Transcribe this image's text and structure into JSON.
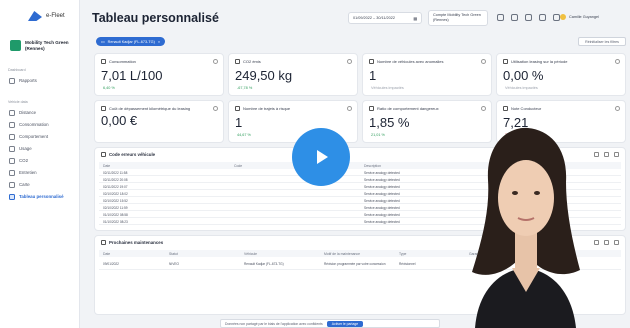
{
  "brand": {
    "name": "e-Fleet"
  },
  "tenant": {
    "name": "Mobility Tech Green (Rennes)"
  },
  "sidebar": {
    "section_general": "Dashboard",
    "section_vehicle": "Vehicle data",
    "items": [
      {
        "label": "Rapports"
      },
      {
        "label": "Distance"
      },
      {
        "label": "Consommation"
      },
      {
        "label": "Comportement"
      },
      {
        "label": "Usage"
      },
      {
        "label": "CO2"
      },
      {
        "label": "Entretien"
      },
      {
        "label": "Carte"
      },
      {
        "label": "Tableau personnalisé"
      }
    ]
  },
  "header": {
    "title": "Tableau personnalisé",
    "date_range": "01/09/2022 – 30/11/2022",
    "company_label": "Compte Mobility Tech Green (Rennes)",
    "user_name": "Camille Guyangel"
  },
  "filter": {
    "chip": "Renault Kadjar (FL-673-TG)",
    "reset": "Réinitialiser les filtres"
  },
  "kpis": [
    {
      "label": "Consommation",
      "value": "7,01 L/100",
      "sub": "6,40 %"
    },
    {
      "label": "CO2 émis",
      "value": "249,50 kg",
      "sub": "-67,78 %"
    },
    {
      "label": "Nombre de véhicules avec anomalies",
      "value": "1",
      "sub": "Véhicules impactés"
    },
    {
      "label": "Utilisation leasing sur la période",
      "value": "0,00 %",
      "sub": "Véhicules impactés"
    },
    {
      "label": "Coût de dépassement kilométrique du leasing",
      "value": "0,00 €",
      "sub": ""
    },
    {
      "label": "Nombre de trajets à risque",
      "value": "1",
      "sub": "44,67 %"
    },
    {
      "label": "Ratio de comportement dangereux",
      "value": "1,85 %",
      "sub": "21,01 %"
    },
    {
      "label": "Note Conducteur",
      "value": "7,21",
      "sub": "3,93 %"
    }
  ],
  "errors_table": {
    "title": "Code erreurs véhicule",
    "columns": [
      "Date",
      "Code",
      "Description"
    ],
    "rows": [
      [
        "02/11/2022 11:58",
        "",
        "Service analogy detected"
      ],
      [
        "02/11/2022 20:08",
        "",
        "Service analogy detected"
      ],
      [
        "02/11/2022 19:07",
        "",
        "Service analogy detected"
      ],
      [
        "02/10/2022 18:02",
        "",
        "Service analogy detected"
      ],
      [
        "02/10/2022 15:52",
        "",
        "Service analogy detected"
      ],
      [
        "02/10/2022 11:59",
        "",
        "Service analogy detected"
      ],
      [
        "01/10/2022 08:58",
        "",
        "Service analogy detected"
      ],
      [
        "01/10/2022 08:23",
        "",
        "Service analogy detected"
      ]
    ]
  },
  "maint_table": {
    "title": "Prochaines maintenances",
    "columns": [
      "Date",
      "Statut",
      "Véhicule",
      "Motif de la maintenance",
      "Type",
      "Garage"
    ],
    "rows": [
      [
        "09/01/2022",
        "NIVEO",
        "Renault Kadjar (FL-673-TG)",
        "Révision programmée par votre concession",
        "Révisionnel",
        ""
      ]
    ]
  },
  "banner": {
    "text": "Données non partagé par le biais de l'application avec confidents",
    "cta": "Activer le partage"
  }
}
